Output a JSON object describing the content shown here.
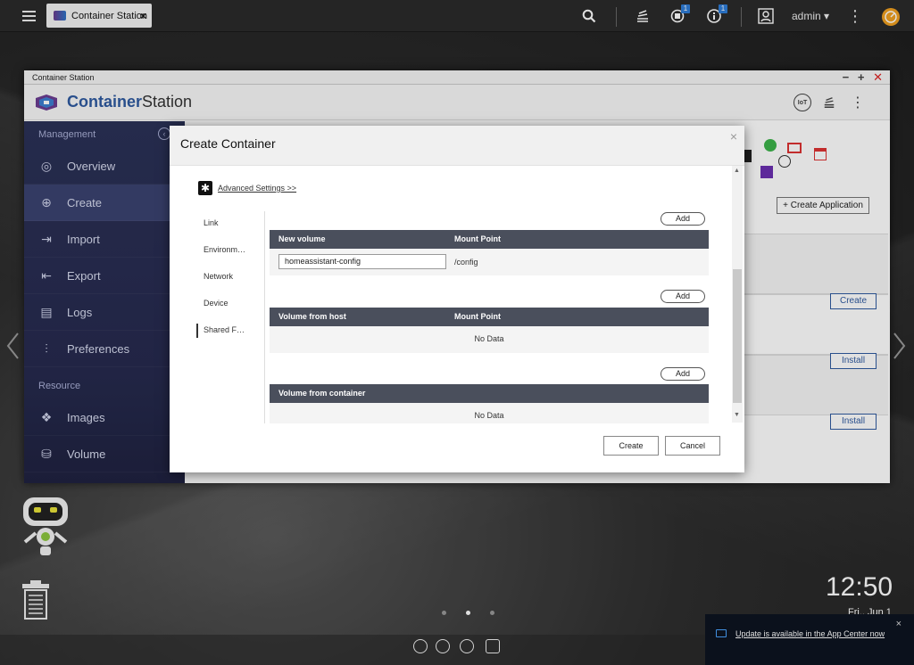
{
  "taskbar": {
    "tab_label": "Container Station",
    "tab_close": "×",
    "badges": {
      "notifications": "1",
      "info": "1"
    },
    "user": "admin",
    "user_caret": "▾"
  },
  "window": {
    "title": "Container Station",
    "controls": {
      "minimize": "−",
      "maximize": "+",
      "close": "✕"
    }
  },
  "app": {
    "name_part1": "Container",
    "name_part2": "Station",
    "iot_label": "IoT"
  },
  "sidebar": {
    "section_management": "Management",
    "section_resource": "Resource",
    "items": [
      {
        "label": "Overview",
        "icon": "◎"
      },
      {
        "label": "Create",
        "icon": "⊕"
      },
      {
        "label": "Import",
        "icon": "⇥"
      },
      {
        "label": "Export",
        "icon": "⇤"
      },
      {
        "label": "Logs",
        "icon": "▤"
      },
      {
        "label": "Preferences",
        "icon": "⫶"
      }
    ],
    "resource_items": [
      {
        "label": "Images",
        "icon": "❖"
      },
      {
        "label": "Volume",
        "icon": "⛁"
      }
    ]
  },
  "background": {
    "create_application": "+ Create Application",
    "row_buttons": [
      "Create",
      "Install",
      "Install"
    ]
  },
  "modal": {
    "title": "Create Container",
    "close": "×",
    "advanced_settings": "Advanced Settings >>",
    "nav": [
      "Link",
      "Environm…",
      "Network",
      "Device",
      "Shared F…"
    ],
    "sections": [
      {
        "add_label": "Add",
        "col1": "New volume",
        "col2": "Mount Point",
        "row": {
          "input_value": "homeassistant-config",
          "mount": "/config"
        }
      },
      {
        "add_label": "Add",
        "col1": "Volume from host",
        "col2": "Mount Point",
        "empty": "No Data"
      },
      {
        "add_label": "Add",
        "col1": "Volume from container",
        "empty": "No Data"
      }
    ],
    "create_button": "Create",
    "cancel_button": "Cancel"
  },
  "desktop": {
    "clock": "12:50",
    "date": "Fri., Jun 1",
    "notification": "Update is available in the App Center now",
    "notification_close": "×"
  },
  "colors": {
    "sidebar": "#2b3157",
    "accent": "#2f5aa0",
    "table_header": "#4a4f5c",
    "badge": "#2e7dd8"
  }
}
